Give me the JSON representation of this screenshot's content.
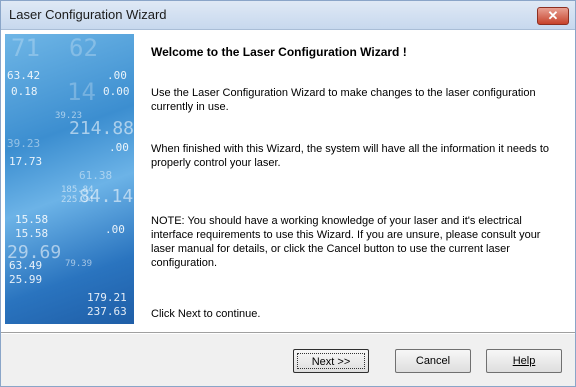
{
  "window": {
    "title": "Laser Configuration Wizard",
    "close_glyph": "✕"
  },
  "content": {
    "heading": "Welcome to the Laser Configuration Wizard !",
    "paragraphs": [
      "Use the Laser Configuration Wizard to make changes to the laser configuration currently in use.",
      "When finished with this Wizard, the system will have all the information it needs to properly control your laser.",
      "NOTE: You should have a working knowledge of your laser and it's electrical interface requirements to use this Wizard. If you are unsure, please consult your laser manual for details, or click the Cancel button to use the current laser configuration.",
      "Click Next to continue."
    ]
  },
  "art_numbers": [
    "71",
    "62",
    "63.42",
    ".00",
    "0.18",
    "14",
    "0.00",
    "39.23",
    "214.88",
    "39.23",
    ".00",
    "17.73",
    "61.38",
    "185.84",
    "225.94",
    "84.14",
    "15.58",
    "15.58",
    ".00",
    "29.69",
    "79.39",
    "63.49",
    "25.99",
    "179.21",
    "237.63"
  ],
  "buttons": {
    "next": "Next >>",
    "cancel": "Cancel",
    "help": "Help"
  }
}
